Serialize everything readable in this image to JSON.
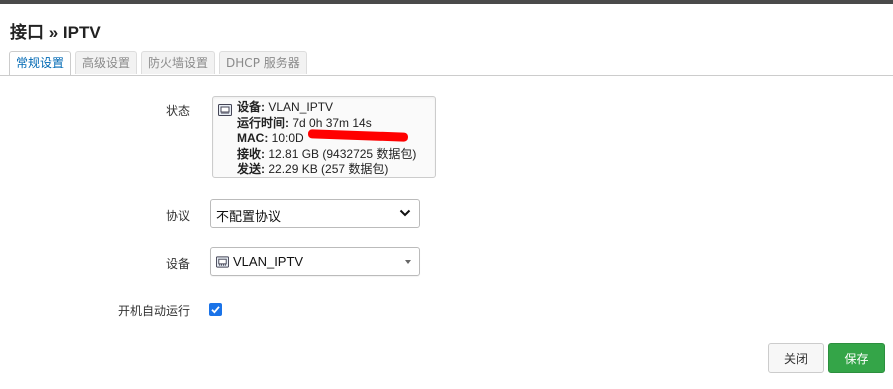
{
  "page": {
    "title": "接口 » IPTV"
  },
  "tabs": [
    {
      "label": "常规设置",
      "active": true
    },
    {
      "label": "高级设置",
      "active": false
    },
    {
      "label": "防火墙设置",
      "active": false
    },
    {
      "label": "DHCP 服务器",
      "active": false
    }
  ],
  "status": {
    "label": "状态",
    "device_key": "设备:",
    "device_val": "VLAN_IPTV",
    "uptime_key": "运行时间:",
    "uptime_val": "7d 0h 37m 14s",
    "mac_key": "MAC:",
    "mac_val": "10:0D",
    "rx_key": "接收:",
    "rx_val": "12.81 GB (9432725 数据包)",
    "tx_key": "发送:",
    "tx_val": "22.29 KB (257 数据包)"
  },
  "protocol": {
    "label": "协议",
    "value": "不配置协议"
  },
  "device": {
    "label": "设备",
    "value": "VLAN_IPTV"
  },
  "autostart": {
    "label": "开机自动运行",
    "checked": true
  },
  "buttons": {
    "close": "关闭",
    "save": "保存"
  },
  "colors": {
    "save": "#34a548",
    "tab_active": "#0069b4",
    "redaction": "#ff0000",
    "checkbox": "#1a73e8"
  },
  "icons": {
    "status": "network-port-icon",
    "device": "network-port-icon"
  }
}
